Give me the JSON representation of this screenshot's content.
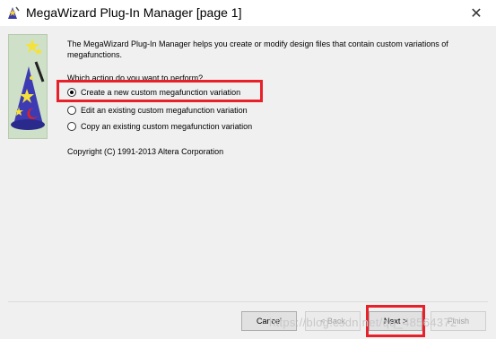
{
  "window": {
    "title": "MegaWizard Plug-In Manager [page 1]",
    "close_glyph": "✕"
  },
  "content": {
    "intro": "The MegaWizard Plug-In Manager helps you create or modify design files that contain custom variations of megafunctions.",
    "question": "Which action do you want to perform?",
    "options": [
      {
        "label": "Create a new custom megafunction variation",
        "selected": true
      },
      {
        "label": "Edit an existing custom megafunction variation",
        "selected": false
      },
      {
        "label": "Copy an existing custom megafunction variation",
        "selected": false
      }
    ],
    "copyright": "Copyright (C) 1991-2013 Altera Corporation"
  },
  "footer": {
    "cancel_label": "Cancel",
    "back_label": "< Back",
    "next_label": "Next >",
    "finish_label": "Finish"
  },
  "watermark": "https://blog.csdn.net/qq_48564372",
  "colors": {
    "highlight": "#e8202a",
    "dialog_bg": "#f0f0f0"
  },
  "icons": {
    "wizard_art": "wizard-hat-wand-icon",
    "app": "wizard-app-icon",
    "close": "close-icon"
  }
}
